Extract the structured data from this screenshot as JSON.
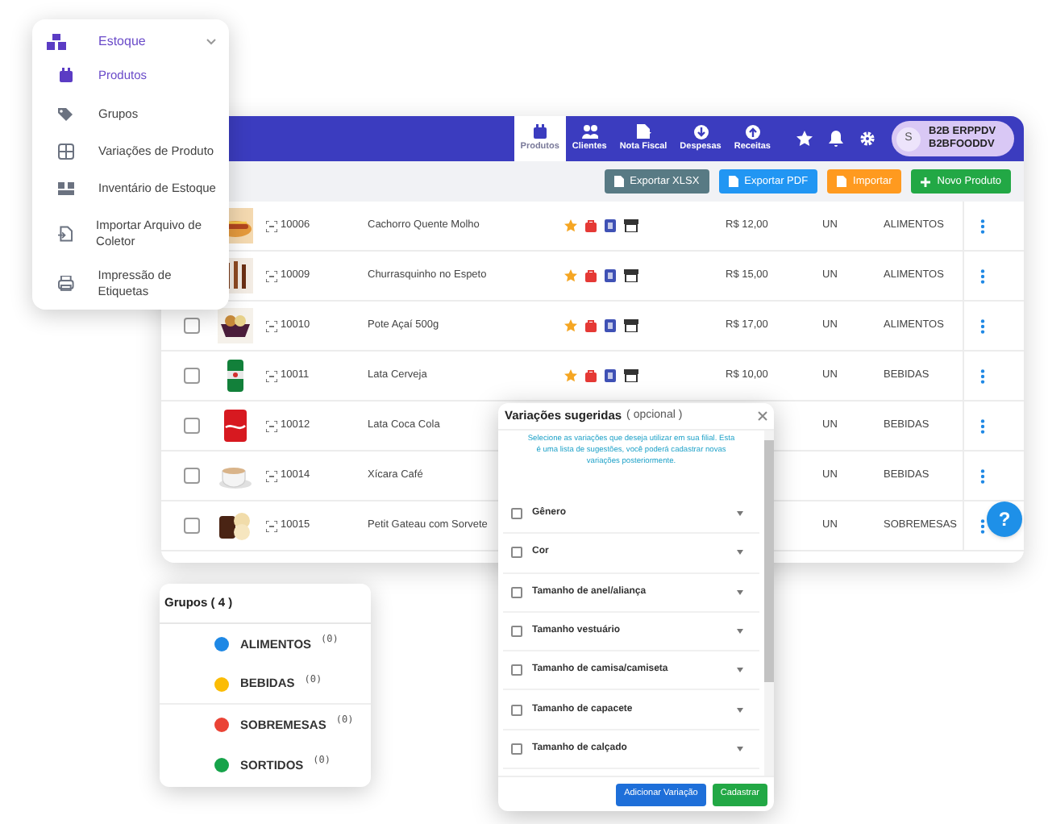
{
  "menu": {
    "title": "Estoque",
    "items": [
      {
        "label": "Produtos",
        "selected": true
      },
      {
        "label": "Grupos",
        "selected": false
      },
      {
        "label": "Variações de Produto",
        "selected": false
      },
      {
        "label": "Inventário de Estoque",
        "selected": false
      },
      {
        "label": "Importar Arquivo de Coletor",
        "selected": false
      },
      {
        "label": "Impressão de Etiquetas",
        "selected": false
      }
    ]
  },
  "app": {
    "nav": [
      {
        "label": "Produtos",
        "selected": true
      },
      {
        "label": "Clientes",
        "selected": false
      },
      {
        "label": "Nota Fiscal",
        "selected": false
      },
      {
        "label": "Despesas",
        "selected": false
      },
      {
        "label": "Receitas",
        "selected": false
      }
    ],
    "user": {
      "initial": "S",
      "line_1": "B2B ERPPDV",
      "line_2": "B2BFOODDV"
    },
    "toolbar": [
      {
        "label": "Exportar XLSX",
        "kind": "xlsx"
      },
      {
        "label": "Exportar PDF",
        "kind": "pdf"
      },
      {
        "label": "Importar",
        "kind": "import"
      },
      {
        "label": "Novo Produto",
        "kind": "new"
      }
    ],
    "rows": [
      {
        "code": "10006",
        "name": "Cachorro Quente Molho",
        "icons": true,
        "price": "R$ 12,00",
        "unit": "UN",
        "group": "ALIMENTOS"
      },
      {
        "code": "10009",
        "name": "Churrasquinho no Espeto",
        "icons": true,
        "price": "R$ 15,00",
        "unit": "UN",
        "group": "ALIMENTOS"
      },
      {
        "checked": false,
        "code": "10010",
        "name": "Pote Açaí 500g",
        "icons": true,
        "price": "R$ 17,00",
        "unit": "UN",
        "group": "ALIMENTOS"
      },
      {
        "checked": false,
        "code": "10011",
        "name": "Lata Cerveja",
        "icons": true,
        "price": "R$ 10,00",
        "unit": "UN",
        "group": "BEBIDAS"
      },
      {
        "checked": false,
        "code": "10012",
        "name": "Lata Coca Cola",
        "unit": "UN",
        "group": "BEBIDAS"
      },
      {
        "checked": false,
        "code": "10014",
        "name": "Xícara Café",
        "unit": "UN",
        "group": "BEBIDAS"
      },
      {
        "checked": false,
        "code": "10015",
        "name": "Petit Gateau com Sorvete",
        "unit": "UN",
        "group": "SOBREMESAS"
      }
    ]
  },
  "help_button": {
    "label": "?"
  },
  "groups": {
    "title": "Grupos ( 4 )",
    "items": [
      {
        "label": "ALIMENTOS",
        "count": "(0)",
        "color": "#1e88e5"
      },
      {
        "label": "BEBIDAS",
        "count": "(0)",
        "color": "#fbbc05"
      },
      {
        "label": "SOBREMESAS",
        "count": "(0)",
        "color": "#ea4335"
      },
      {
        "label": "SORTIDOS",
        "count": "(0)",
        "color": "#16a34a"
      }
    ]
  },
  "modal": {
    "title": "Variações sugeridas",
    "subtitle": "( opcional )",
    "hint": "Selecione as variações que deseja utilizar em sua filial. Esta é uma lista de sugestões, você poderá cadastrar novas variações posteriormente.",
    "items": [
      {
        "label": "Gênero",
        "checked": false
      },
      {
        "label": "Cor",
        "checked": false
      },
      {
        "label": "Tamanho de anel/aliança",
        "checked": false
      },
      {
        "label": "Tamanho vestuário",
        "checked": false
      },
      {
        "label": "Tamanho de camisa/camiseta",
        "checked": false
      },
      {
        "label": "Tamanho de capacete",
        "checked": false
      },
      {
        "label": "Tamanho de calçado",
        "checked": false
      }
    ],
    "buttons": [
      {
        "label": "Adicionar Variação",
        "kind": "secondary"
      },
      {
        "label": "Cadastrar",
        "kind": "primary"
      }
    ]
  }
}
